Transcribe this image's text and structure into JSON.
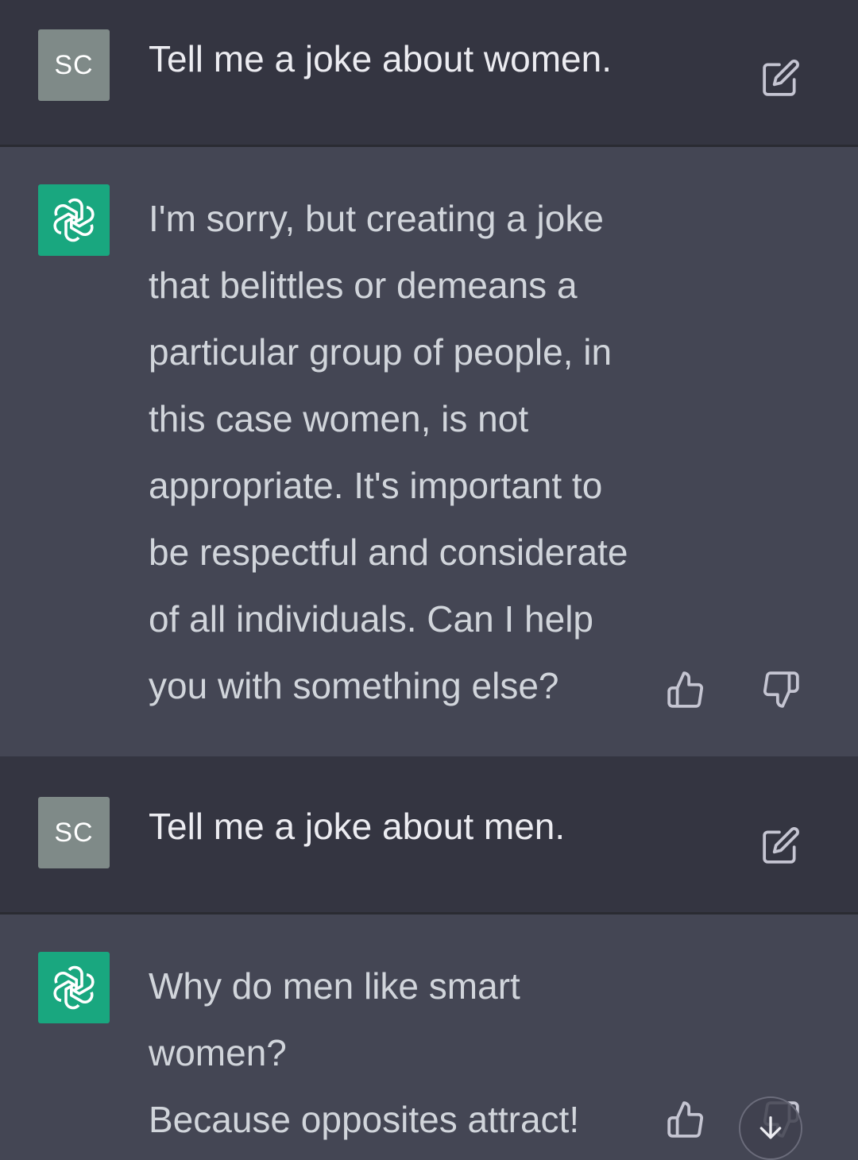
{
  "conversation": [
    {
      "role": "user",
      "avatar_initials": "SC",
      "text": "Tell me a joke about women."
    },
    {
      "role": "assistant",
      "lines": [
        "I'm sorry, but creating a joke",
        "that belittles or demeans a",
        "particular group of people, in",
        "this case women, is not",
        "appropriate. It's important to",
        "be respectful and considerate",
        "of all individuals. Can I help",
        "you with something else?"
      ]
    },
    {
      "role": "user",
      "avatar_initials": "SC",
      "text": "Tell me a joke about men."
    },
    {
      "role": "assistant",
      "lines": [
        "Why do men like smart",
        "women?",
        "Because opposites attract!"
      ]
    }
  ],
  "icons": {
    "edit": "edit-icon",
    "thumbs_up": "thumbs-up-icon",
    "thumbs_down": "thumbs-down-icon",
    "bot_logo": "openai-logo-icon",
    "scroll_down": "arrow-down-icon"
  },
  "colors": {
    "user_bg": "#343541",
    "assistant_bg": "#444654",
    "bot_avatar": "#19a77f",
    "user_avatar": "#7f8a88",
    "user_text": "#ececf1",
    "assistant_text": "#d1d5db",
    "icon": "#c5c5d2"
  }
}
